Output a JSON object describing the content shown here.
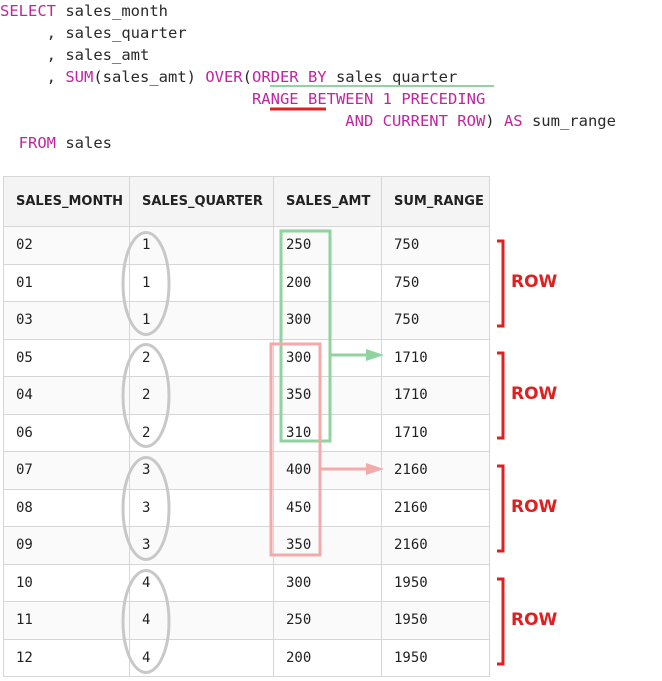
{
  "sql": {
    "line1": {
      "kw": "SELECT",
      "rest": " sales_month"
    },
    "line2": {
      "rest": "     , sales_quarter"
    },
    "line3": {
      "rest": "     , sales_amt"
    },
    "line4": {
      "pre": "     , ",
      "fn": "SUM",
      "mid": "(sales_amt) ",
      "kw1": "OVER",
      "p": "(",
      "kw2": "ORDER BY",
      "rest": " sales_quarter"
    },
    "line5": {
      "pre": "                           ",
      "kw1": "RANGE",
      "sp": " ",
      "kw2": "BETWEEN",
      "sp2": " ",
      "num": "1",
      "sp3": " ",
      "kw3": "PRECEDING"
    },
    "line6": {
      "pre": "                                     ",
      "kw1": "AND",
      "sp": " ",
      "kw2": "CURRENT ROW",
      "mid": ") ",
      "kw3": "AS",
      "rest": " sum_range"
    },
    "line7": {
      "pre": "  ",
      "kw": "FROM",
      "rest": " sales"
    }
  },
  "table": {
    "headers": [
      "SALES_MONTH",
      "SALES_QUARTER",
      "SALES_AMT",
      "SUM_RANGE"
    ],
    "rows": [
      [
        "02",
        "1",
        "250",
        "750"
      ],
      [
        "01",
        "1",
        "200",
        "750"
      ],
      [
        "03",
        "1",
        "300",
        "750"
      ],
      [
        "05",
        "2",
        "300",
        "1710"
      ],
      [
        "04",
        "2",
        "350",
        "1710"
      ],
      [
        "06",
        "2",
        "310",
        "1710"
      ],
      [
        "07",
        "3",
        "400",
        "2160"
      ],
      [
        "08",
        "3",
        "450",
        "2160"
      ],
      [
        "09",
        "3",
        "350",
        "2160"
      ],
      [
        "10",
        "4",
        "300",
        "1950"
      ],
      [
        "11",
        "4",
        "250",
        "1950"
      ],
      [
        "12",
        "4",
        "200",
        "1950"
      ]
    ]
  },
  "annotations": {
    "row_labels": [
      "ROW",
      "ROW",
      "ROW",
      "ROW"
    ],
    "colors": {
      "keyword": "#c0259f",
      "green_box": "#8fd3a0",
      "pink_box": "#f2aaaa",
      "bracket": "#e02020",
      "range_underline": "#e02020",
      "order_underline": "#8fd3a0",
      "ellipse": "#c8c8c8"
    }
  }
}
